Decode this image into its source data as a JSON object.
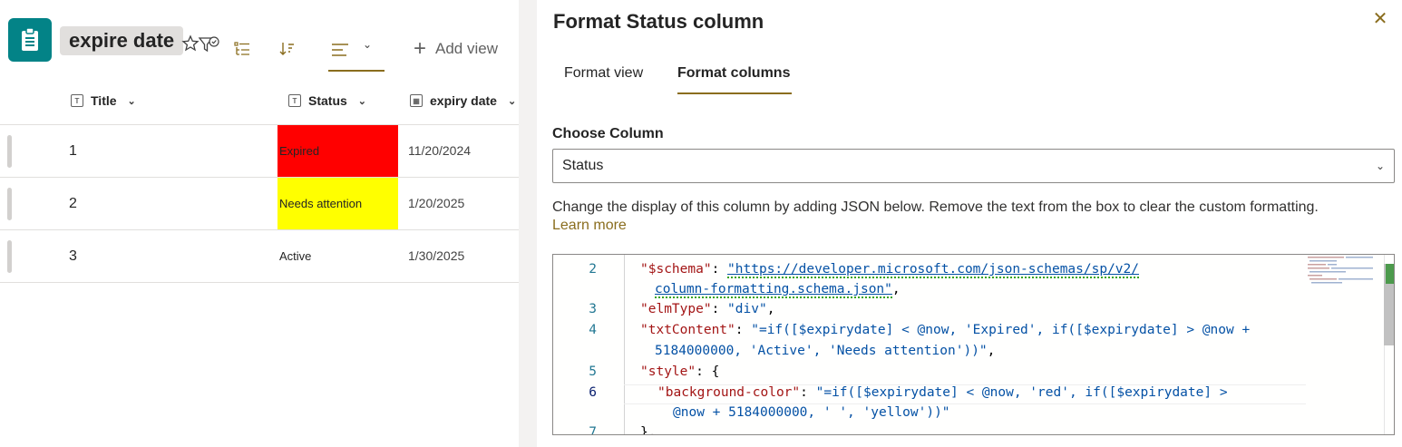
{
  "list": {
    "title": "expire date",
    "add_view_label": "Add view"
  },
  "table": {
    "columns": [
      {
        "label": "Title",
        "icon": "text-field-icon"
      },
      {
        "label": "Status",
        "icon": "text-field-icon"
      },
      {
        "label": "expiry date",
        "icon": "calendar-icon"
      }
    ],
    "rows": [
      {
        "title": "1",
        "status": "Expired",
        "status_color": "#ff0000",
        "date": "11/20/2024"
      },
      {
        "title": "2",
        "status": "Needs attention",
        "status_color": "#ffff00",
        "date": "1/20/2025"
      },
      {
        "title": "3",
        "status": "Active",
        "status_color": "#ffffff",
        "date": "1/30/2025"
      }
    ]
  },
  "panel": {
    "title": "Format Status column",
    "tabs": [
      "Format view",
      "Format columns"
    ],
    "active_tab": "Format columns",
    "choose_column_label": "Choose Column",
    "selected_column": "Status",
    "description": "Change the display of this column by adding JSON below. Remove the text from the box to clear the custom formatting.",
    "learn_more": "Learn more"
  },
  "editor": {
    "line_numbers": [
      "2",
      "3",
      "4",
      "5",
      "6",
      "7"
    ],
    "current_line": "6",
    "lines": {
      "l2a_key": "\"$schema\"",
      "l2a_sep": ": ",
      "l2a_url": "\"https://developer.microsoft.com/json-schemas/sp/v2/",
      "l2b_url": "column-formatting.schema.json\"",
      "l2b_tail": ",",
      "l3_key": "\"elmType\"",
      "l3_sep": ": ",
      "l3_val": "\"div\"",
      "l3_tail": ",",
      "l4a_key": "\"txtContent\"",
      "l4a_sep": ": ",
      "l4a_val": "\"=if([$expirydate] < @now, 'Expired', if([$expirydate] > @now +",
      "l4b_val": "5184000000, 'Active', 'Needs attention'))\"",
      "l4b_tail": ",",
      "l5_key": "\"style\"",
      "l5_tail": ": {",
      "l6a_key": "\"background-color\"",
      "l6a_sep": ": ",
      "l6a_val": "\"=if([$expirydate] < @now, 'red', if([$expirydate] >",
      "l6b_val": "@now + 5184000000, ' ', 'yellow'))\"",
      "l7": "},"
    }
  },
  "colors": {
    "accent": "#8a6d1e",
    "app_icon": "#038387"
  }
}
